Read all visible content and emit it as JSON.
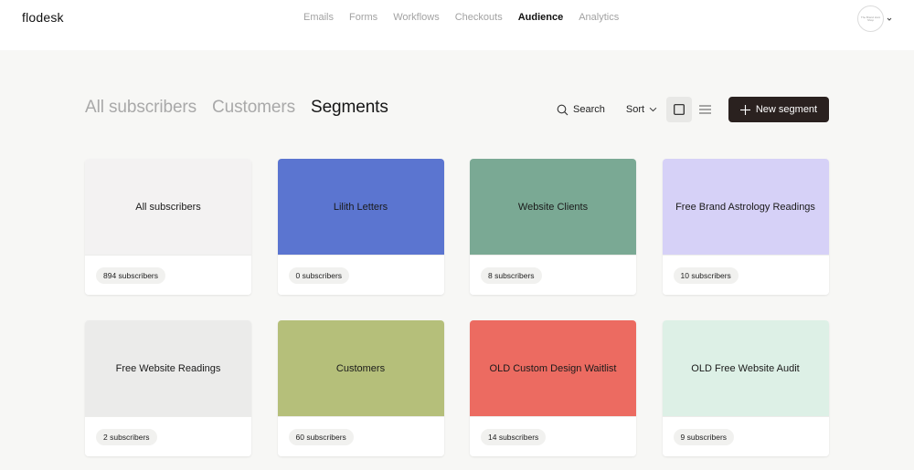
{
  "app": {
    "logo": "flodesk"
  },
  "nav": {
    "items": [
      {
        "label": "Emails",
        "active": false
      },
      {
        "label": "Forms",
        "active": false
      },
      {
        "label": "Workflows",
        "active": false
      },
      {
        "label": "Checkouts",
        "active": false
      },
      {
        "label": "Audience",
        "active": true
      },
      {
        "label": "Analytics",
        "active": false
      }
    ]
  },
  "account": {
    "avatar_text": "The Brand Hunt Shop"
  },
  "tabs": [
    {
      "label": "All subscribers",
      "active": false
    },
    {
      "label": "Customers",
      "active": false
    },
    {
      "label": "Segments",
      "active": true
    }
  ],
  "toolbar": {
    "search_label": "Search",
    "sort_label": "Sort",
    "new_segment_label": "New segment"
  },
  "segments": [
    {
      "name": "All subscribers",
      "count": "894 subscribers",
      "color": "#f3f2f2"
    },
    {
      "name": "Lilith Letters",
      "count": "0 subscribers",
      "color": "#5b75d0"
    },
    {
      "name": "Website Clients",
      "count": "8 subscribers",
      "color": "#7aa994"
    },
    {
      "name": "Free Brand Astrology Readings",
      "count": "10 subscribers",
      "color": "#d6d1f7"
    },
    {
      "name": "Free Website Readings",
      "count": "2 subscribers",
      "color": "#ebebea"
    },
    {
      "name": "Customers",
      "count": "60 subscribers",
      "color": "#b5bf7a"
    },
    {
      "name": "OLD Custom Design Waitlist",
      "count": "14 subscribers",
      "color": "#ec6b61"
    },
    {
      "name": "OLD Free Website Audit",
      "count": "9 subscribers",
      "color": "#ddf0e6"
    }
  ]
}
